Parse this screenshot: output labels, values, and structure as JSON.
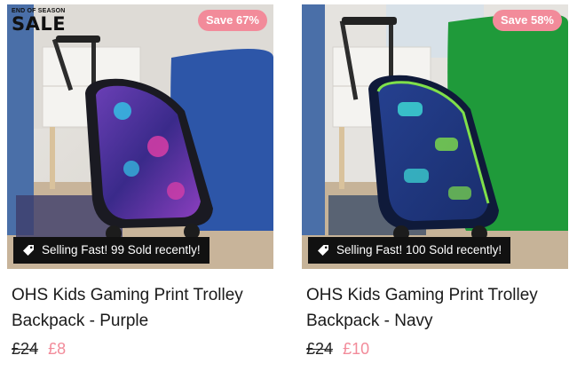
{
  "promo": {
    "line1": "END OF SEASON",
    "line2": "SALE"
  },
  "products": [
    {
      "save_label": "Save 67%",
      "sold_label": "Selling Fast! 99 Sold recently!",
      "title": "OHS Kids Gaming Print Trolley Backpack - Purple",
      "was_price": "£24",
      "now_price": "£8"
    },
    {
      "save_label": "Save 58%",
      "sold_label": "Selling Fast! 100 Sold recently!",
      "title": "OHS Kids Gaming Print Trolley Backpack - Navy",
      "was_price": "£24",
      "now_price": "£10"
    }
  ],
  "colors": {
    "accent": "#f28b9a",
    "banner": "#111111",
    "text": "#1a1a1a"
  },
  "icons": {
    "sold_banner": "tag-icon"
  }
}
